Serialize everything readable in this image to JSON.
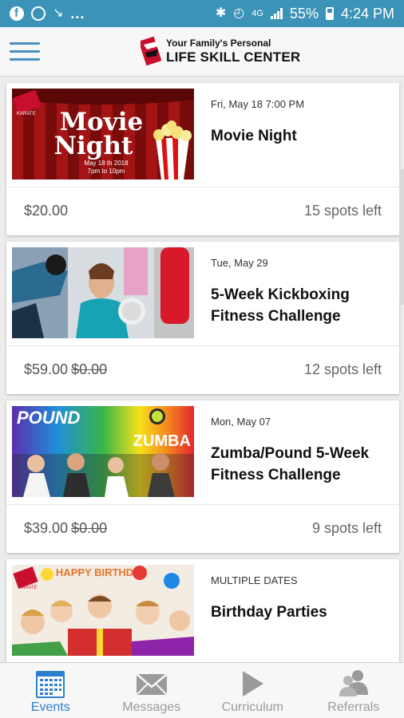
{
  "status_bar": {
    "dots": "...",
    "network": "4G",
    "battery": "55%",
    "time": "4:24 PM"
  },
  "header": {
    "logo_line1": "Your Family's Personal",
    "logo_line2": "LIFE SKILL CENTER"
  },
  "events": [
    {
      "date": "Fri, May 18 7:00 PM",
      "title": "Movie Night",
      "price": "$20.00",
      "old_price": "",
      "spots": "15 spots left",
      "image": {
        "badge": "KARATE",
        "word1": "Movie",
        "word2": "Night",
        "line1": "May 18 th 2018",
        "line2": "7pm to 10pm"
      }
    },
    {
      "date": "Tue, May 29",
      "title": "5-Week Kickboxing Fitness Challenge",
      "price": "$59.00",
      "old_price": "$0.00",
      "spots": "12 spots left",
      "image": {}
    },
    {
      "date": "Mon, May 07",
      "title": "Zumba/Pound 5-Week Fitness Challenge",
      "price": "$39.00",
      "old_price": "$0.00",
      "spots": "9 spots left",
      "image": {
        "word1": "POUND",
        "word2": "ZUMBA"
      }
    },
    {
      "date": "MULTIPLE DATES",
      "title": "Birthday Parties",
      "price": "",
      "old_price": "",
      "spots": "",
      "image": {
        "banner": "HAPPY BIRTHDAY",
        "badge": "KARATE"
      }
    }
  ],
  "bottom_nav": [
    {
      "label": "Events",
      "icon": "calendar-icon",
      "active": true
    },
    {
      "label": "Messages",
      "icon": "envelope-icon",
      "active": false
    },
    {
      "label": "Curriculum",
      "icon": "play-icon",
      "active": false
    },
    {
      "label": "Referrals",
      "icon": "people-icon",
      "active": false
    }
  ],
  "colors": {
    "status_bar": "#3b93b8",
    "accent": "#2d7fd0",
    "hamburger": "#4a90c2"
  }
}
